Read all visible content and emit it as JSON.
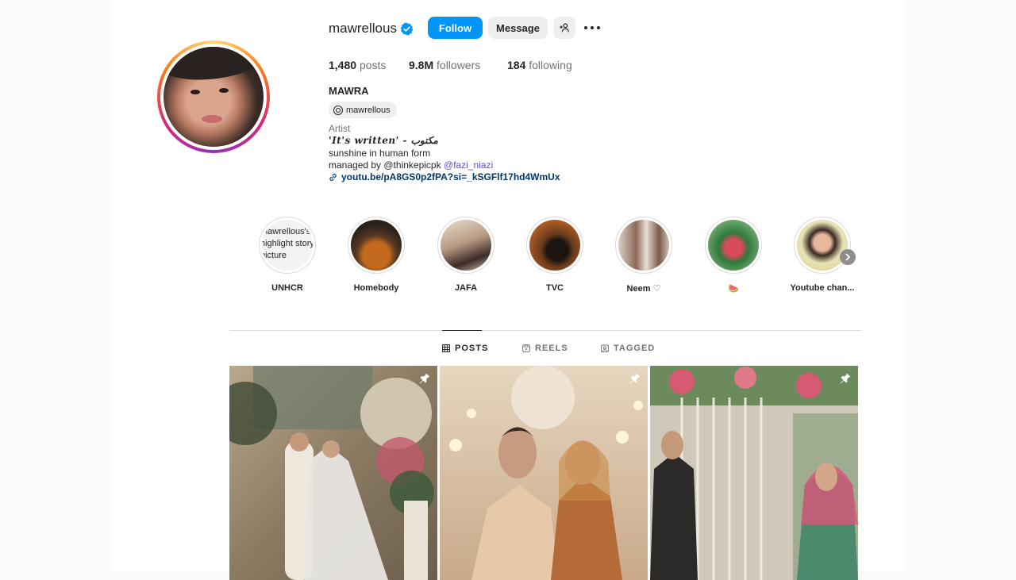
{
  "profile": {
    "username": "mawrellous",
    "follow_label": "Follow",
    "message_label": "Message",
    "fullname": "MAWRA",
    "threads_handle": "mawrellous",
    "category": "Artist",
    "bio_line1": "'It's written' - مکتوب",
    "bio_line2": "sunshine in human form",
    "bio_line3_prefix": "managed by @thinkepicpk ",
    "bio_line3_mention": "@fazi_niazi",
    "link": "youtu.be/pA8GS0p2fPA?si=_kSGFlf17hd4WmUx"
  },
  "stats": {
    "posts_count": "1,480",
    "posts_label": "posts",
    "followers_count": "9.8M",
    "followers_label": "followers",
    "following_count": "184",
    "following_label": "following"
  },
  "highlights": [
    {
      "label": "UNHCR",
      "thumb_text": "mawrellous's highlight story picture"
    },
    {
      "label": "Homebody"
    },
    {
      "label": "JAFA"
    },
    {
      "label": "TVC"
    },
    {
      "label": "Neem ♡"
    },
    {
      "label": "🍉"
    },
    {
      "label": "Youtube chan..."
    }
  ],
  "tabs": [
    {
      "label": "POSTS",
      "active": true
    },
    {
      "label": "REELS",
      "active": false
    },
    {
      "label": "TAGGED",
      "active": false
    }
  ],
  "colors": {
    "follow_blue": "#0095f6",
    "link_blue": "#00376b",
    "mention_purple": "#5b51d8",
    "verified_blue": "#0095f6"
  },
  "icons": [
    "verified-icon",
    "add-user-icon",
    "more-icon",
    "threads-icon",
    "link-icon",
    "grid-icon",
    "reels-icon",
    "tagged-icon",
    "pin-icon",
    "chevron-right-icon"
  ]
}
